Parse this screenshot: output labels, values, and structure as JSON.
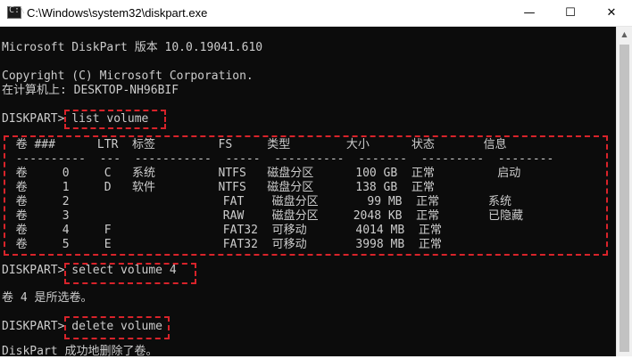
{
  "window": {
    "title": "C:\\Windows\\system32\\diskpart.exe",
    "icon": "console-icon",
    "buttons": {
      "minimize": "—",
      "maximize": "☐",
      "close": "✕"
    }
  },
  "console": {
    "lines": [
      "Microsoft DiskPart 版本 10.0.19041.610",
      "",
      "Copyright (C) Microsoft Corporation.",
      "在计算机上: DESKTOP-NH96BIF",
      "",
      "DISKPART> list volume",
      "",
      "  卷 ###      LTR  标签         FS     类型        大小      状态       信息",
      "  ----------  ---  -----------  -----  ----------  -------  ---------  --------",
      "  卷     0     C   系统         NTFS   磁盘分区      100 GB  正常         启动",
      "  卷     1     D   软件         NTFS   磁盘分区      138 GB  正常",
      "  卷     2                      FAT    磁盘分区       99 MB  正常       系统",
      "  卷     3                      RAW    磁盘分区     2048 KB  正常       已隐藏",
      "  卷     4     F                FAT32  可移动       4014 MB  正常",
      "  卷     5     E                FAT32  可移动       3998 MB  正常",
      "",
      "DISKPART> select volume 4",
      "",
      "卷 4 是所选卷。",
      "",
      "DISKPART> delete volume",
      "",
      "DiskPart 成功地删除了卷。"
    ]
  },
  "colors": {
    "console_bg": "#0c0c0c",
    "console_fg": "#cccccc",
    "highlight": "#d8232a"
  }
}
